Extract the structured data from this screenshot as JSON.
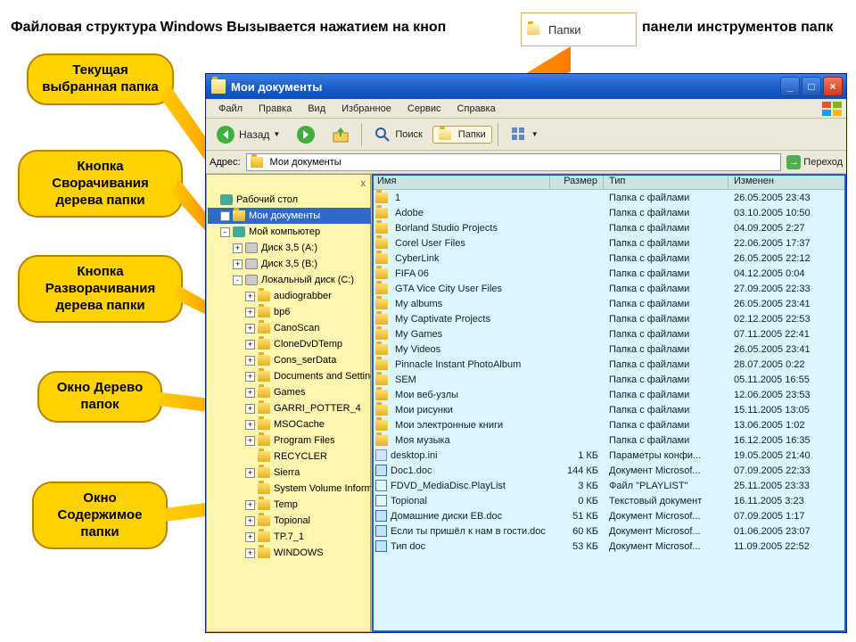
{
  "header": {
    "left": "Файловая структура Windows Вызывается нажатием на кноп",
    "right": "панели инструментов папк"
  },
  "top_button": {
    "label": "Папки"
  },
  "bubbles": {
    "b1": "Текущая выбранная папка",
    "b2": "Кнопка Сворачивания дерева папки",
    "b3": "Кнопка Разворачивания дерева папки",
    "b4": "Окно Дерево папок",
    "b5": "Окно Содержимое папки"
  },
  "window": {
    "title": "Мои документы",
    "menu": [
      "Файл",
      "Правка",
      "Вид",
      "Избранное",
      "Сервис",
      "Справка"
    ],
    "toolbar": {
      "back": "Назад",
      "search": "Поиск",
      "folders": "Папки"
    },
    "addr_label": "Адрес:",
    "addr_value": "Мои документы",
    "go": "Переход",
    "tree_close": "x",
    "columns": {
      "name": "Имя",
      "size": "Размер",
      "type": "Тип",
      "mod": "Изменен"
    }
  },
  "tree": [
    {
      "ind": 0,
      "exp": "",
      "ico": "desktop",
      "label": "Рабочий стол"
    },
    {
      "ind": 1,
      "exp": "+",
      "ico": "folder",
      "label": "Мои документы",
      "sel": true
    },
    {
      "ind": 1,
      "exp": "-",
      "ico": "desktop",
      "label": "Мой компьютер"
    },
    {
      "ind": 2,
      "exp": "+",
      "ico": "drive",
      "label": "Диск 3,5 (A:)"
    },
    {
      "ind": 2,
      "exp": "+",
      "ico": "drive",
      "label": "Диск 3,5 (B:)"
    },
    {
      "ind": 2,
      "exp": "-",
      "ico": "drive",
      "label": "Локальный диск (C:)"
    },
    {
      "ind": 3,
      "exp": "+",
      "ico": "folder",
      "label": "audiograbber"
    },
    {
      "ind": 3,
      "exp": "+",
      "ico": "folder",
      "label": "bp6"
    },
    {
      "ind": 3,
      "exp": "+",
      "ico": "folder",
      "label": "CanoScan"
    },
    {
      "ind": 3,
      "exp": "+",
      "ico": "folder",
      "label": "CloneDvDTemp"
    },
    {
      "ind": 3,
      "exp": "+",
      "ico": "folder",
      "label": "Cons_serData"
    },
    {
      "ind": 3,
      "exp": "+",
      "ico": "folder",
      "label": "Documents and Settings"
    },
    {
      "ind": 3,
      "exp": "+",
      "ico": "folder",
      "label": "Games"
    },
    {
      "ind": 3,
      "exp": "+",
      "ico": "folder",
      "label": "GARRI_POTTER_4"
    },
    {
      "ind": 3,
      "exp": "+",
      "ico": "folder",
      "label": "MSOCache"
    },
    {
      "ind": 3,
      "exp": "+",
      "ico": "folder",
      "label": "Program Files"
    },
    {
      "ind": 3,
      "exp": "",
      "ico": "folder",
      "label": "RECYCLER"
    },
    {
      "ind": 3,
      "exp": "+",
      "ico": "folder",
      "label": "Sierra"
    },
    {
      "ind": 3,
      "exp": "",
      "ico": "folder",
      "label": "System Volume Information"
    },
    {
      "ind": 3,
      "exp": "+",
      "ico": "folder",
      "label": "Temp"
    },
    {
      "ind": 3,
      "exp": "+",
      "ico": "folder",
      "label": "Topional"
    },
    {
      "ind": 3,
      "exp": "+",
      "ico": "folder",
      "label": "TP.7_1"
    },
    {
      "ind": 3,
      "exp": "+",
      "ico": "folder",
      "label": "WINDOWS"
    }
  ],
  "files": [
    {
      "ico": "folder",
      "name": "1",
      "size": "",
      "type": "Папка с файлами",
      "mod": "26.05.2005 23:43"
    },
    {
      "ico": "folder",
      "name": "Adobe",
      "size": "",
      "type": "Папка с файлами",
      "mod": "03.10.2005 10:50"
    },
    {
      "ico": "folder",
      "name": "Borland Studio Projects",
      "size": "",
      "type": "Папка с файлами",
      "mod": "04.09.2005 2:27"
    },
    {
      "ico": "folder",
      "name": "Corel User Files",
      "size": "",
      "type": "Папка с файлами",
      "mod": "22.06.2005 17:37"
    },
    {
      "ico": "folder",
      "name": "CyberLink",
      "size": "",
      "type": "Папка с файлами",
      "mod": "26.05.2005 22:12"
    },
    {
      "ico": "folder",
      "name": "FIFA 06",
      "size": "",
      "type": "Папка с файлами",
      "mod": "04.12.2005 0:04"
    },
    {
      "ico": "folder",
      "name": "GTA Vice City User Files",
      "size": "",
      "type": "Папка с файлами",
      "mod": "27.09.2005 22:33"
    },
    {
      "ico": "folder",
      "name": "My albums",
      "size": "",
      "type": "Папка с файлами",
      "mod": "26.05.2005 23:41"
    },
    {
      "ico": "folder",
      "name": "My Captivate Projects",
      "size": "",
      "type": "Папка с файлами",
      "mod": "02.12.2005 22:53"
    },
    {
      "ico": "folder",
      "name": "My Games",
      "size": "",
      "type": "Папка с файлами",
      "mod": "07.11.2005 22:41"
    },
    {
      "ico": "folder",
      "name": "My Videos",
      "size": "",
      "type": "Папка с файлами",
      "mod": "26.05.2005 23:41"
    },
    {
      "ico": "folder",
      "name": "Pinnacle Instant PhotoAlbum",
      "size": "",
      "type": "Папка с файлами",
      "mod": "28.07.2005 0:22"
    },
    {
      "ico": "folder",
      "name": "SEM",
      "size": "",
      "type": "Папка с файлами",
      "mod": "05.11.2005 16:55"
    },
    {
      "ico": "folder",
      "name": "Мои веб-узлы",
      "size": "",
      "type": "Папка с файлами",
      "mod": "12.06.2005 23:53"
    },
    {
      "ico": "folder",
      "name": "Мои рисунки",
      "size": "",
      "type": "Папка с файлами",
      "mod": "15.11.2005 13:05"
    },
    {
      "ico": "folder",
      "name": "Мои электронные книги",
      "size": "",
      "type": "Папка с файлами",
      "mod": "13.06.2005 1:02"
    },
    {
      "ico": "folder",
      "name": "Моя музыка",
      "size": "",
      "type": "Папка с файлами",
      "mod": "16.12.2005 16:35"
    },
    {
      "ico": "ini",
      "name": "desktop.ini",
      "size": "1 КБ",
      "type": "Параметры конфи...",
      "mod": "19.05.2005 21:40"
    },
    {
      "ico": "doc",
      "name": "Doc1.doc",
      "size": "144 КБ",
      "type": "Документ Microsof...",
      "mod": "07.09.2005 22:33"
    },
    {
      "ico": "txt",
      "name": "FDVD_MediaDisc.PlayList",
      "size": "3 КБ",
      "type": "Файл \"PLAYLIST\"",
      "mod": "25.11.2005 23:33"
    },
    {
      "ico": "txt",
      "name": "Topional",
      "size": "0 КБ",
      "type": "Текстовый документ",
      "mod": "16.11.2005 3:23"
    },
    {
      "ico": "doc",
      "name": "Домашние диски EB.doc",
      "size": "51 КБ",
      "type": "Документ Microsof...",
      "mod": "07.09.2005 1:17"
    },
    {
      "ico": "doc",
      "name": "Если ты пришёл к нам в гости.doc",
      "size": "60 КБ",
      "type": "Документ Microsof...",
      "mod": "01.06.2005 23:07"
    },
    {
      "ico": "doc",
      "name": "Тип doc",
      "size": "53 КБ",
      "type": "Документ Microsof...",
      "mod": "11.09.2005 22:52"
    }
  ]
}
